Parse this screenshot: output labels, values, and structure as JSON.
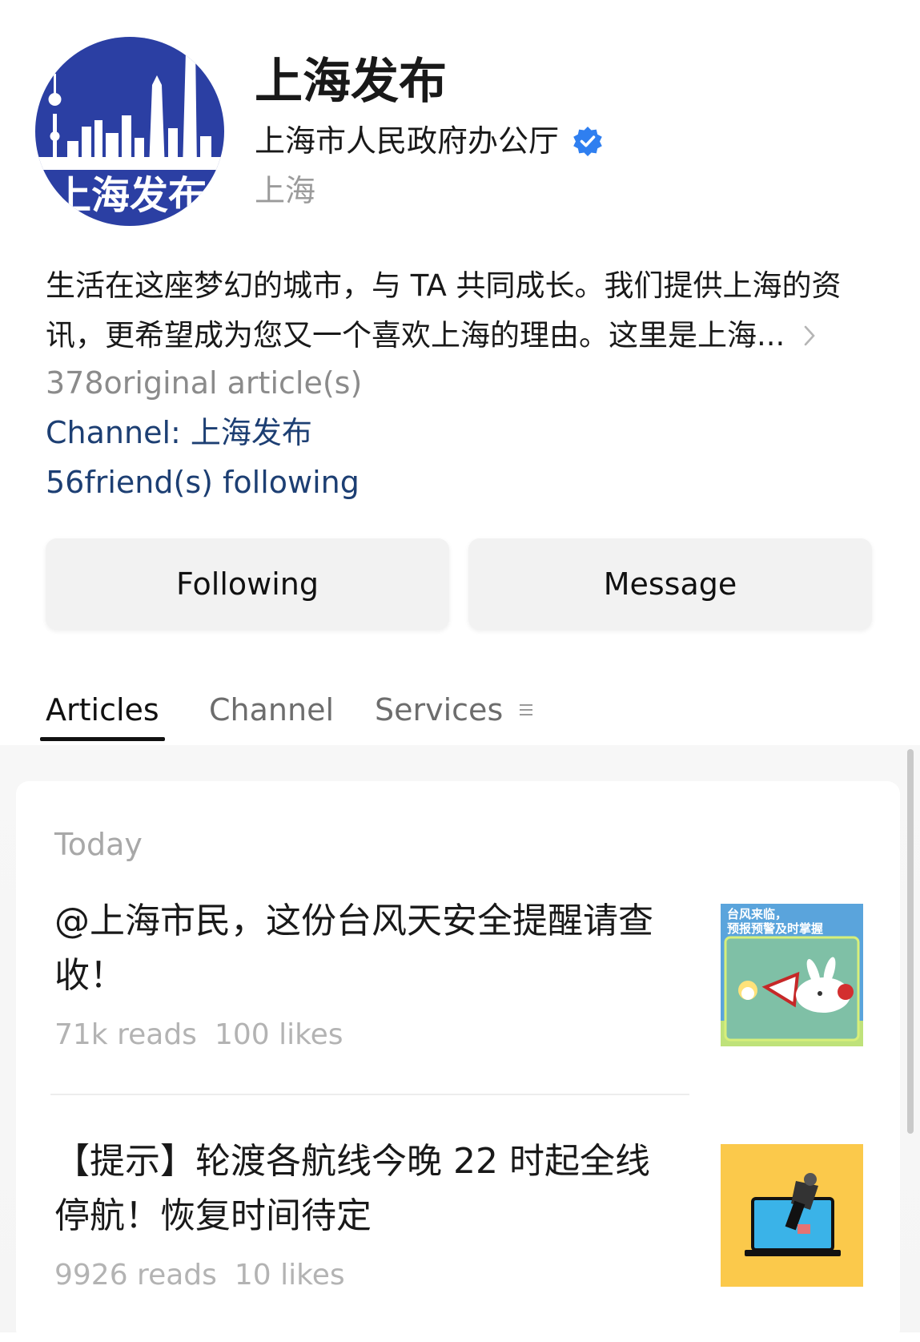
{
  "profile": {
    "name": "上海发布",
    "owner": "上海市人民政府办公厅",
    "location": "上海",
    "description_line1": "生活在这座梦幻的城市，与 TA 共同成长。我们提供上海的资",
    "description_line2": "讯，更希望成为您又一个喜欢上海的理由。这里是上海...",
    "original_articles": "378original article(s)",
    "channel": "Channel: 上海发布",
    "friends_following": "56friend(s) following",
    "avatar_text": "上海发布",
    "colors": {
      "brand_blue": "#2b3fa3",
      "link": "#1d3f73",
      "verified": "#2f7ff0"
    }
  },
  "actions": {
    "following_label": "Following",
    "message_label": "Message"
  },
  "tabs": [
    {
      "label": "Articles",
      "active": true
    },
    {
      "label": "Channel",
      "active": false
    },
    {
      "label": "Services",
      "active": false,
      "icon": "menu-icon"
    }
  ],
  "feed": {
    "date_header": "Today",
    "articles": [
      {
        "title": "@上海市民，这份台风天安全提醒请查收！",
        "reads": "71k reads",
        "likes": "100 likes",
        "thumb_text_1": "台风来临，",
        "thumb_text_2": "预报预警及时掌握"
      },
      {
        "title": "【提示】轮渡各航线今晚 22 时起全线停航！恢复时间待定",
        "reads": "9926 reads",
        "likes": "10 likes"
      }
    ]
  }
}
